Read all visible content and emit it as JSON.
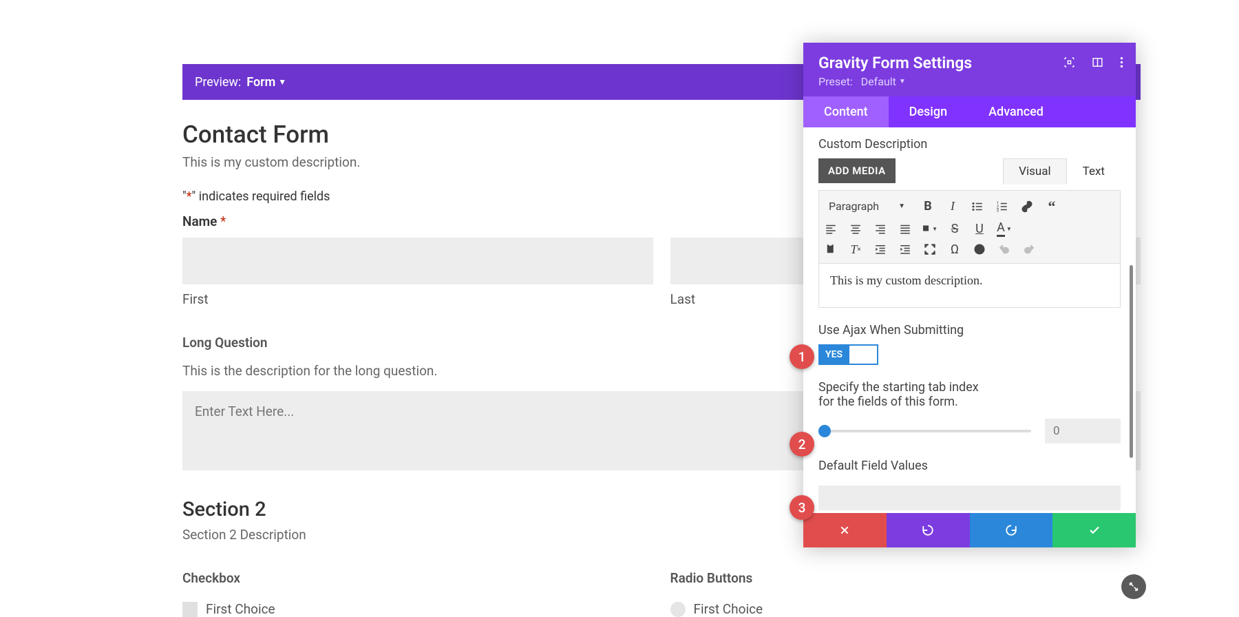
{
  "previewBar": {
    "label": "Preview:",
    "mode": "Form"
  },
  "form": {
    "title": "Contact Form",
    "desc": "This is my custom description.",
    "required_prefix": "\"",
    "required_star": "*",
    "required_suffix": "\" indicates required fields",
    "name_label": "Name",
    "first_label": "First",
    "last_label": "Last",
    "long_q_label": "Long Question",
    "long_q_desc": "This is the description for the long question.",
    "long_q_placeholder": "Enter Text Here...",
    "sec2_title": "Section 2",
    "sec2_desc": "Section 2 Description",
    "checkbox_label": "Checkbox",
    "radio_label": "Radio Buttons",
    "choice1": "First Choice"
  },
  "panel": {
    "title": "Gravity Form Settings",
    "preset_label": "Preset:",
    "preset_value": "Default",
    "tabs": {
      "content": "Content",
      "design": "Design",
      "advanced": "Advanced"
    },
    "custom_desc_label": "Custom Description",
    "add_media": "ADD MEDIA",
    "editor_tabs": {
      "visual": "Visual",
      "text": "Text"
    },
    "format_select": "Paragraph",
    "editor_content": "This is my custom description.",
    "ajax_label": "Use Ajax When Submitting",
    "ajax_toggle": "YES",
    "tabindex_label_1": "Specify the starting tab index",
    "tabindex_label_2": "for the fields of this form.",
    "tabindex_value": "0",
    "default_values_label": "Default Field Values"
  },
  "markers": {
    "m1": "1",
    "m2": "2",
    "m3": "3"
  }
}
